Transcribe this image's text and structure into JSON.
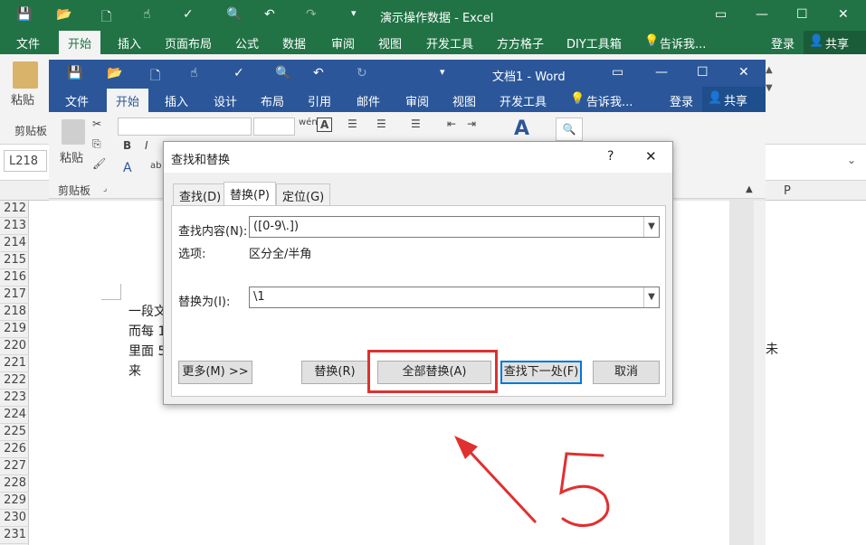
{
  "excel": {
    "title": "演示操作数据 - Excel",
    "tabs": [
      "文件",
      "开始",
      "插入",
      "页面布局",
      "公式",
      "数据",
      "审阅",
      "视图",
      "开发工具",
      "方方格子",
      "DIY工具箱"
    ],
    "tell_me": "告诉我...",
    "login": "登录",
    "share": "共享",
    "paste_label": "粘贴",
    "clipboard_group": "剪贴板",
    "namebox": "L218",
    "col_p": "P",
    "rows": [
      "212",
      "213",
      "214",
      "215",
      "216",
      "217",
      "218",
      "219",
      "220",
      "221",
      "222",
      "223",
      "224",
      "225",
      "226",
      "227",
      "228",
      "229",
      "230",
      "231"
    ]
  },
  "word": {
    "title": "文档1 - Word",
    "tabs": [
      "文件",
      "开始",
      "插入",
      "设计",
      "布局",
      "引用",
      "邮件",
      "审阅",
      "视图",
      "开发工具"
    ],
    "tell_me": "告诉我...",
    "login": "登录",
    "share": "共享",
    "paste_label": "粘贴",
    "clipboard_group": "剪贴板",
    "doc_lines": [
      "一段文",
      "而每 1",
      "里面 5",
      "来"
    ],
    "doc_right_char": "未"
  },
  "dialog": {
    "title": "查找和替换",
    "help": "?",
    "close": "✕",
    "tabs": [
      "查找(D)",
      "替换(P)",
      "定位(G)"
    ],
    "find_label": "查找内容(N):",
    "find_value": "([0-9\\.])",
    "options_label": "选项:",
    "options_value": "区分全/半角",
    "replace_label": "替换为(I):",
    "replace_value": "\\1",
    "more_btn": "更多(M) >>",
    "replace_btn": "替换(R)",
    "replace_all_btn": "全部替换(A)",
    "find_next_btn": "查找下一处(F)",
    "cancel_btn": "取消"
  },
  "annotation": {
    "step_number": "5",
    "color": "#e03030"
  }
}
